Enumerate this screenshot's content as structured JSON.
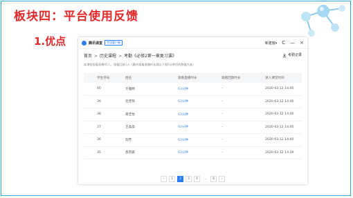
{
  "slide": {
    "title": "板块四：平台使用反馈",
    "subhead": "1.优点"
  },
  "window": {
    "app_name": "腾讯课堂",
    "app_tag": "专用客户端",
    "user": "新建窗▾",
    "controls": [
      "C",
      "—",
      "×"
    ]
  },
  "breadcrumb": [
    "首页",
    "历史课程",
    "考勤《必修2第一章复习课》"
  ],
  "download_label": "考勤记录",
  "note": "本课程观看直播45人，观看回放1人（最终观看直播时长满以下限5分钟后的数据为准）",
  "table": {
    "headers": [
      "学生序号",
      "姓名",
      "观看直播时长",
      "观看回放时长",
      "进入课堂时间"
    ],
    "rows": [
      [
        "40",
        "于雅婷",
        "63分钟",
        "-",
        "2020-03-12 14:40"
      ],
      [
        "39",
        "毛佳琦",
        "63分钟",
        "-",
        "2020-03-12 14:40"
      ],
      [
        "38",
        "蒋佳怡",
        "63分钟",
        "-",
        "2020-03-12 14:40"
      ],
      [
        "37",
        "王晶晶",
        "63分钟",
        "-",
        "2020-03-12 14:40"
      ],
      [
        "36",
        "刘芳",
        "63分钟",
        "-",
        "2020-03-12 14:40"
      ],
      [
        "35",
        "袁宗震",
        "63分钟",
        "-",
        "2020-03-12 14:39"
      ]
    ]
  },
  "pagination": {
    "prev": "‹",
    "pages": [
      "1",
      "2",
      "3",
      "4",
      "…",
      "8"
    ],
    "next": "›",
    "current": "2"
  },
  "colors": {
    "title_red": "#e22828",
    "accent_blue": "#2b7cf6",
    "frame_blue": "#29a3d6"
  }
}
